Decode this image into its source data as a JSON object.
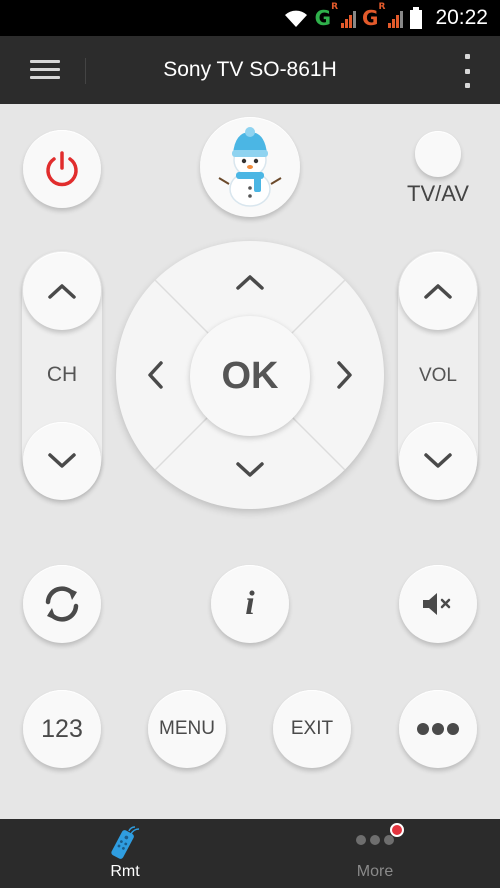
{
  "status_bar": {
    "time": "20:22",
    "net1": "G",
    "net2": "G",
    "roaming": "R"
  },
  "header": {
    "title": "Sony TV SO-861H"
  },
  "buttons": {
    "tv_av": "TV/AV",
    "ch_label": "CH",
    "vol_label": "VOL",
    "ok": "OK",
    "info": "i",
    "num": "123",
    "menu": "MENU",
    "exit": "EXIT"
  },
  "icons": {
    "power": "power-icon",
    "mascot": "snowman-icon",
    "refresh": "refresh-icon",
    "mute": "mute-icon",
    "more_dots": "dots-icon"
  },
  "colors": {
    "power_red": "#e12d2d",
    "tab_active": "#2f9de0",
    "badge": "#e3343f"
  },
  "tabs": [
    {
      "label": "Rmt",
      "active": true
    },
    {
      "label": "More",
      "active": false,
      "badge": true
    }
  ]
}
